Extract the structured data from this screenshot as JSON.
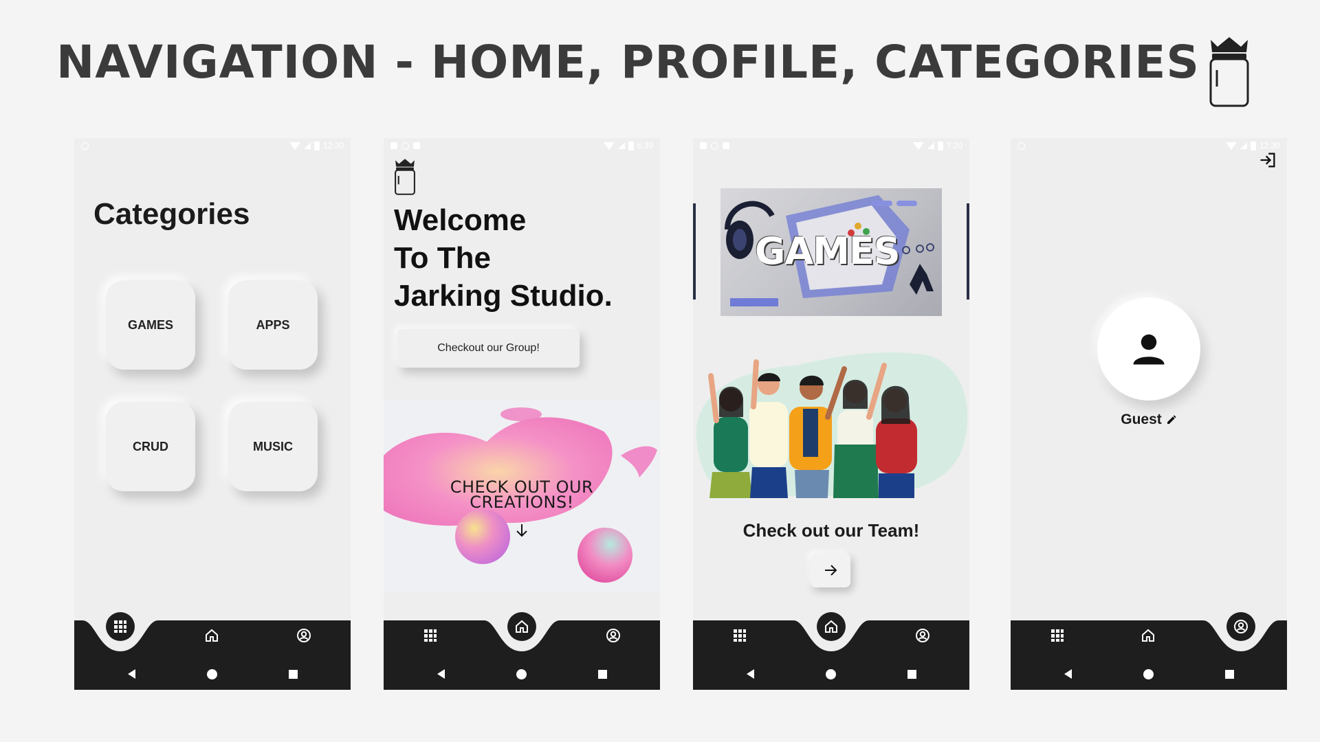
{
  "slide": {
    "title": "NAVIGATION - HOME, PROFILE, CATEGORIES"
  },
  "status_times": [
    "12:30",
    "6:39",
    "7:20",
    "12:30"
  ],
  "categories_screen": {
    "title": "Categories",
    "cards": [
      "GAMES",
      "APPS",
      "CRUD",
      "MUSIC"
    ]
  },
  "home_screen": {
    "welcome_line1": "Welcome",
    "welcome_line2": "To The",
    "welcome_line3": "Jarking Studio.",
    "group_button": "Checkout our Group!",
    "creations_line1": "CHECK OUT OUR",
    "creations_line2": "CREATIONS!"
  },
  "games_screen": {
    "banner_text": "GAMES",
    "team_title": "Check out our Team!"
  },
  "profile_screen": {
    "name": "Guest"
  },
  "icons": {
    "logo": "crowned-jar-icon",
    "grid": "grid-icon",
    "home": "home-icon",
    "profile": "account-circle-icon",
    "logout": "login-icon",
    "edit": "pencil-icon"
  },
  "colors": {
    "background": "#f4f4f4",
    "navbar": "#1e1e1e",
    "screen": "#eeeeee"
  }
}
